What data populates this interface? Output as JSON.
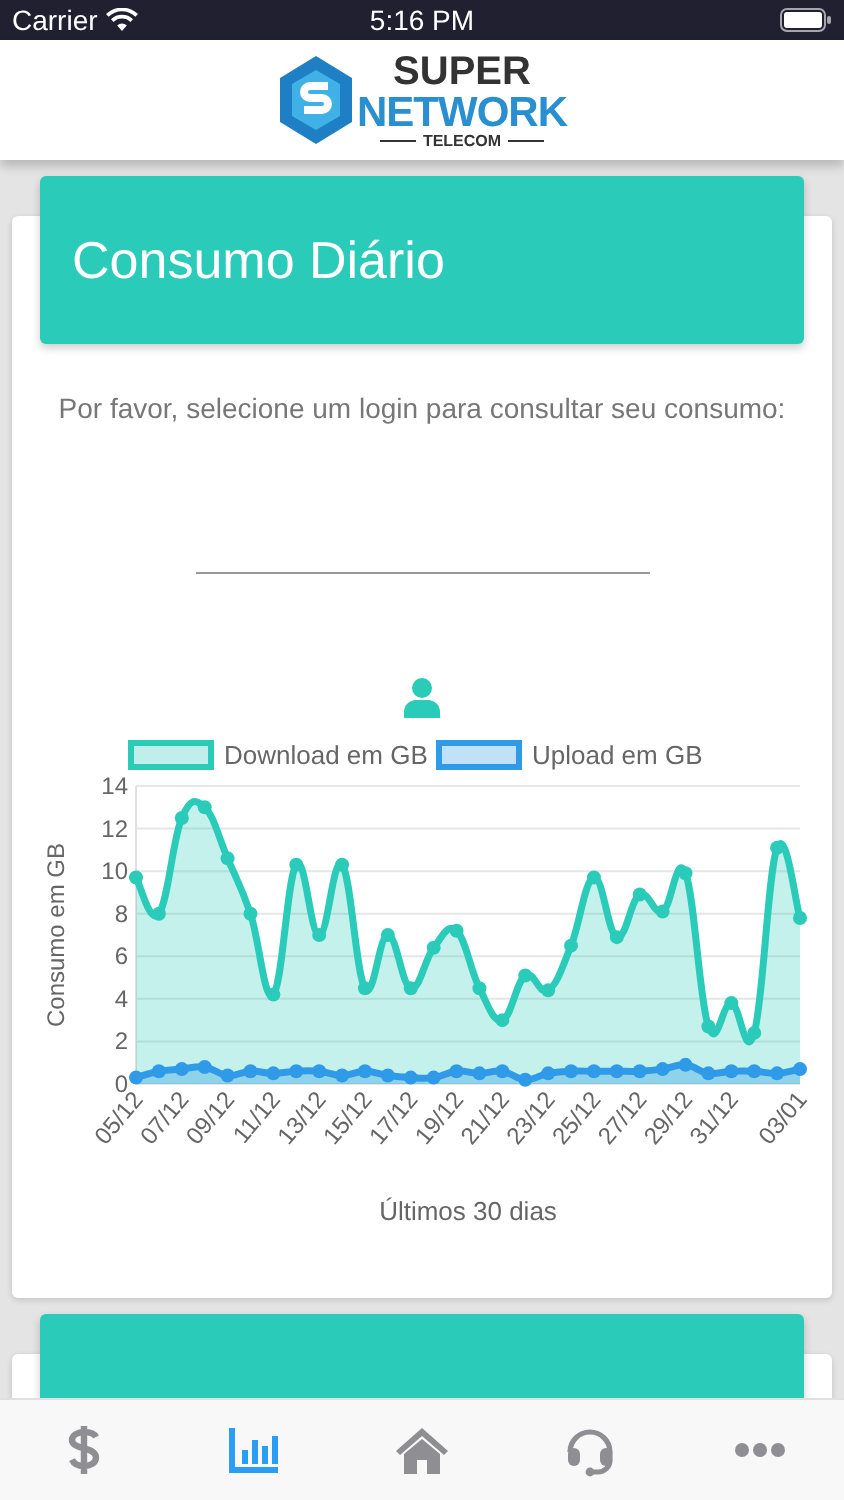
{
  "status_bar": {
    "carrier": "Carrier",
    "time": "5:16 PM"
  },
  "header": {
    "logo_top": "SUPER",
    "logo_main": "NETWORK",
    "logo_sub": "TELECOM"
  },
  "cards": [
    {
      "kind": "full",
      "title": "Consumo Diário",
      "prompt": "Por favor, selecione um login para consultar seu consumo:",
      "login_field": true,
      "chart_data": {
        "type": "area",
        "xlabel": "Últimos 30 dias",
        "ylabel": "Consumo em GB",
        "ylim": [
          0,
          14
        ],
        "yticks": [
          0,
          2,
          4,
          6,
          8,
          10,
          12,
          14
        ],
        "grid": true,
        "legend": true,
        "categories": [
          "05/12",
          null,
          "07/12",
          null,
          "09/12",
          null,
          "11/12",
          null,
          "13/12",
          null,
          "15/12",
          null,
          "17/12",
          null,
          "19/12",
          null,
          "21/12",
          null,
          "23/12",
          null,
          "25/12",
          null,
          "27/12",
          null,
          "29/12",
          null,
          "31/12",
          null,
          null,
          "03/01"
        ],
        "series": [
          {
            "name": "Download em GB",
            "color": "#2bcbba",
            "values": [
              9.7,
              8.0,
              12.5,
              13.0,
              10.6,
              8.0,
              4.2,
              10.3,
              7.0,
              10.3,
              4.5,
              7.0,
              4.5,
              6.4,
              7.2,
              4.5,
              3.0,
              5.1,
              4.4,
              6.5,
              9.7,
              6.9,
              8.9,
              8.1,
              9.9,
              2.7,
              3.8,
              2.4,
              11.1,
              7.8
            ]
          },
          {
            "name": "Upload em GB",
            "color": "#2f9be8",
            "values": [
              0.3,
              0.6,
              0.7,
              0.8,
              0.4,
              0.6,
              0.5,
              0.6,
              0.6,
              0.4,
              0.6,
              0.4,
              0.3,
              0.3,
              0.6,
              0.5,
              0.6,
              0.2,
              0.5,
              0.6,
              0.6,
              0.6,
              0.6,
              0.7,
              0.9,
              0.5,
              0.6,
              0.6,
              0.5,
              0.7
            ]
          }
        ]
      }
    },
    {
      "kind": "cut"
    }
  ],
  "tab_bar": [
    {
      "kind": "dollar",
      "selected": false
    },
    {
      "kind": "chart",
      "selected": true
    },
    {
      "kind": "home",
      "selected": false
    },
    {
      "kind": "support",
      "selected": false
    },
    {
      "kind": "more",
      "selected": false
    }
  ]
}
